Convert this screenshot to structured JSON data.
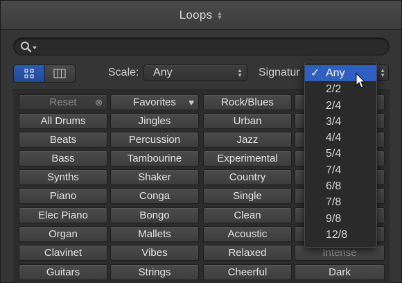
{
  "window": {
    "title": "Loops"
  },
  "search": {
    "placeholder": ""
  },
  "filters": {
    "scale_label": "Scale:",
    "scale_value": "Any",
    "signature_label": "Signatur"
  },
  "keywords": [
    [
      "Reset",
      "Favorites",
      "Rock/Blues"
    ],
    [
      "All Drums",
      "Jingles",
      "Urban"
    ],
    [
      "Beats",
      "Percussion",
      "Jazz"
    ],
    [
      "Bass",
      "Tambourine",
      "Experimental"
    ],
    [
      "Synths",
      "Shaker",
      "Country"
    ],
    [
      "Piano",
      "Conga",
      "Single"
    ],
    [
      "Elec Piano",
      "Bongo",
      "Clean"
    ],
    [
      "Organ",
      "Mallets",
      "Acoustic"
    ],
    [
      "Clavinet",
      "Vibes",
      "Relaxed"
    ],
    [
      "Guitars",
      "Strings",
      "Cheerful"
    ]
  ],
  "fourth_column": {
    "intense": "Intense",
    "dark": "Dark"
  },
  "signature_menu": {
    "checkmark": "✓",
    "items": [
      "Any",
      "2/2",
      "2/4",
      "3/4",
      "4/4",
      "5/4",
      "7/4",
      "6/8",
      "7/8",
      "9/8",
      "12/8"
    ],
    "selected_index": 0
  },
  "colors": {
    "accent": "#2f5fbf",
    "background": "#353535"
  },
  "icons": {
    "reset_clear": "close-circle-icon",
    "favorites": "heart-icon",
    "search": "search-icon"
  }
}
